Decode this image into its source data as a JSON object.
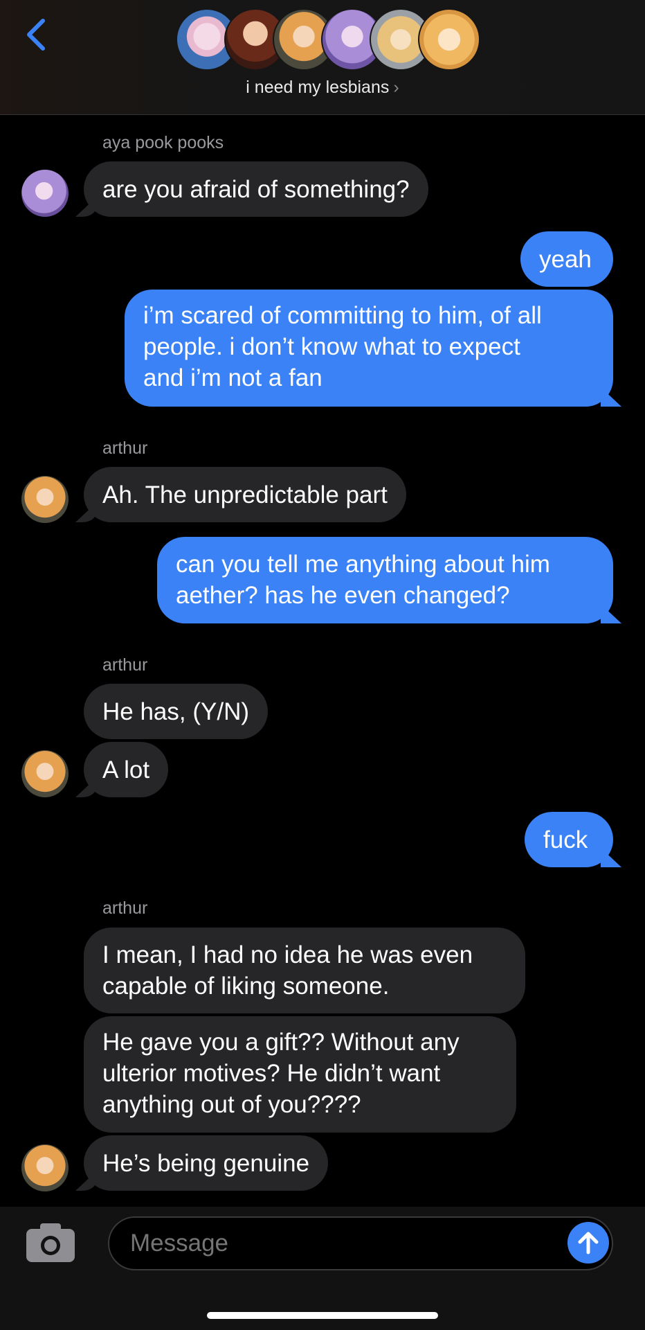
{
  "header": {
    "group_name": "i need my lesbians",
    "chevron": "›",
    "back_icon": "chevron-left-icon",
    "accent": "#3b82f6"
  },
  "messages": {
    "m1": {
      "sender": "aya pook pooks",
      "text": "are you afraid of something?"
    },
    "m2": {
      "text": "yeah"
    },
    "m3": {
      "lines": [
        "i’m scared of committing to him, of all",
        "people. i don’t know what to expect",
        "and i’m not a fan"
      ]
    },
    "m4": {
      "sender": "arthur",
      "text": "Ah. The unpredictable part"
    },
    "m5": {
      "lines": [
        "can you tell me anything about him",
        "aether? has he even changed?"
      ]
    },
    "m6": {
      "sender": "arthur",
      "text": "He has, (Y/N)"
    },
    "m7": {
      "text": "A lot"
    },
    "m8": {
      "text": "fuck"
    },
    "m9": {
      "sender": "arthur",
      "lines": [
        "I mean, I had no idea he was even",
        "capable of liking someone."
      ]
    },
    "m10": {
      "lines": [
        "He gave you a gift?? Without any",
        "ulterior motives? He didn’t want",
        "anything out of you????"
      ]
    },
    "m11": {
      "text": "He’s being genuine"
    }
  },
  "composer": {
    "placeholder": "Message",
    "camera_icon": "camera-icon",
    "send_icon": "arrow-up-icon"
  },
  "colors": {
    "incoming_bubble": "#262629",
    "outgoing_bubble": "#3b82f6",
    "background": "#000000"
  }
}
